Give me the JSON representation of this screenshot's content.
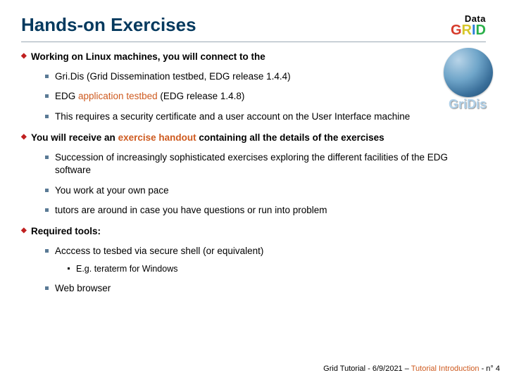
{
  "title": "Hands-on Exercises",
  "logo": {
    "data": "Data",
    "grid": "GRID"
  },
  "gridis": "GriDis",
  "b1": {
    "lead": "Working on Linux machines, you will connect to the",
    "s1": "Gri.Dis (Grid Dissemination testbed, EDG release 1.4.4)",
    "s2_a": "EDG ",
    "s2_b": "application testbed",
    "s2_c": " (EDG release 1.4.8)",
    "s3": "This requires a security certificate and a user account on the User Interface machine"
  },
  "b2": {
    "lead_a": "You will receive an ",
    "lead_b": "exercise handout",
    "lead_c": " containing all the details of the exercises",
    "s1": "Succession of increasingly sophisticated exercises exploring the different facilities of the EDG software",
    "s2": "You work at your own pace",
    "s3": "tutors are around in case you have questions or run into problem"
  },
  "b3": {
    "lead": "Required tools:",
    "s1": "Acccess to tesbed via secure shell (or equivalent)",
    "s1_1": "E.g. teraterm for Windows",
    "s2": "Web browser"
  },
  "footer": {
    "a": "Grid Tutorial ",
    "b": " - 6/9/2021 – ",
    "c": "Tutorial Introduction",
    "d": " - n° 4"
  }
}
